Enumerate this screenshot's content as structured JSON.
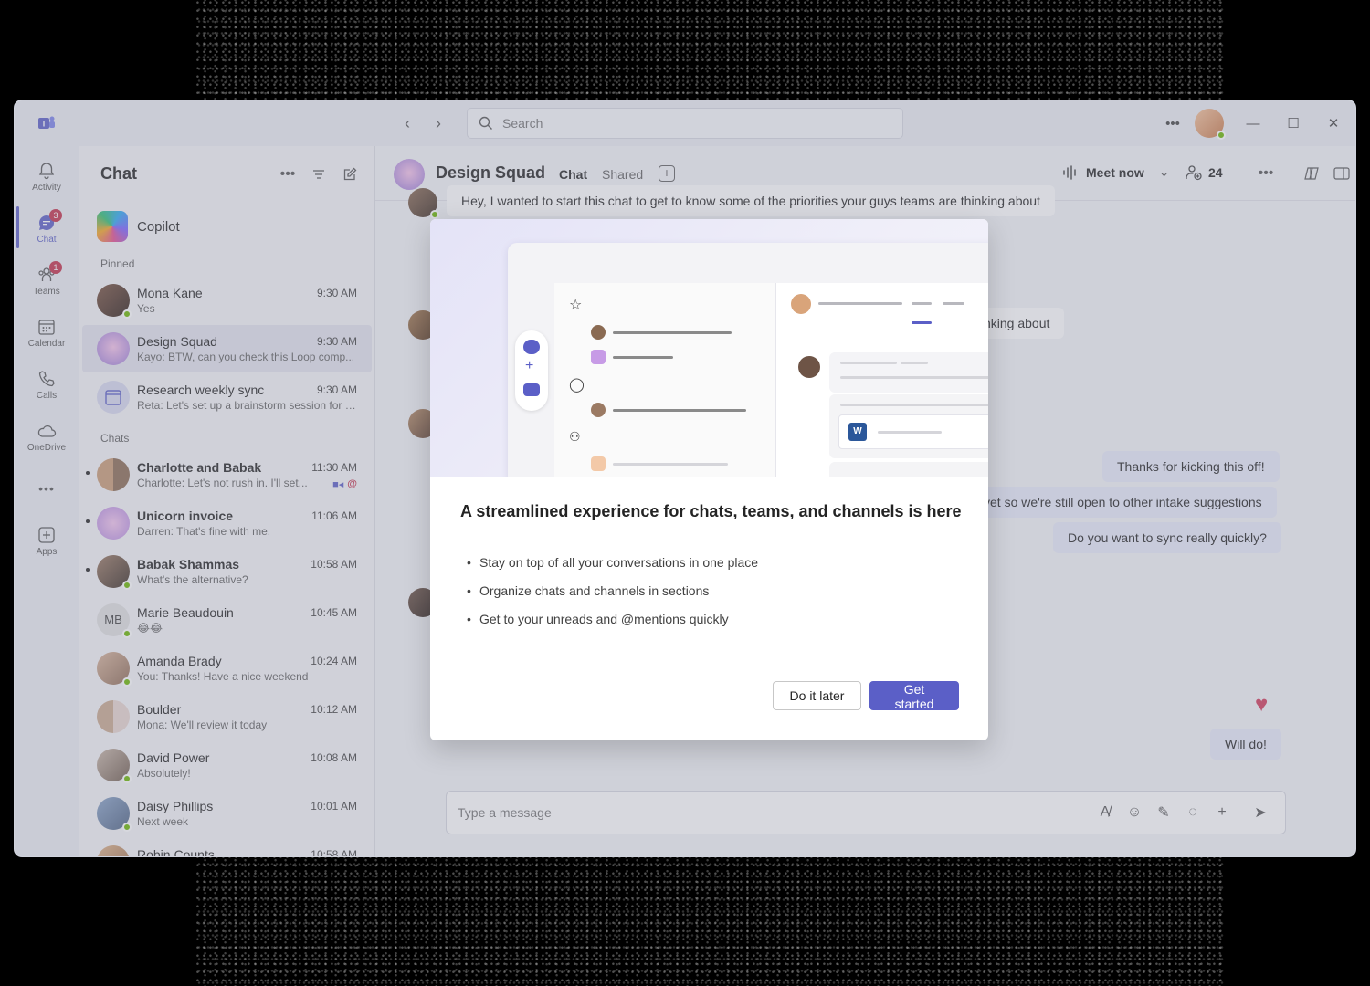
{
  "app": {
    "search_placeholder": "Search"
  },
  "rail": {
    "items": [
      {
        "label": "Activity",
        "icon": "bell-icon"
      },
      {
        "label": "Chat",
        "icon": "chat-icon",
        "badge": "3"
      },
      {
        "label": "Teams",
        "icon": "teams-icon",
        "badge": "1"
      },
      {
        "label": "Calendar",
        "icon": "calendar-icon"
      },
      {
        "label": "Calls",
        "icon": "phone-icon"
      },
      {
        "label": "OneDrive",
        "icon": "cloud-icon"
      },
      {
        "label": "Apps",
        "icon": "apps-add-icon"
      }
    ]
  },
  "chatlist": {
    "title": "Chat",
    "copilot_label": "Copilot",
    "pinned_label": "Pinned",
    "chats_label": "Chats",
    "pinned": [
      {
        "name": "Mona Kane",
        "time": "9:30 AM",
        "preview": "Yes"
      },
      {
        "name": "Design Squad",
        "time": "9:30 AM",
        "preview": "Kayo: BTW, can you check this Loop comp..."
      },
      {
        "name": "Research weekly sync",
        "time": "9:30 AM",
        "preview": "Reta: Let's set up a brainstorm session for t..."
      }
    ],
    "chats": [
      {
        "name": "Charlotte and Babak",
        "time": "11:30 AM",
        "preview": "Charlotte: Let's not rush in. I'll set..."
      },
      {
        "name": "Unicorn invoice",
        "time": "11:06 AM",
        "preview": "Darren: That's fine with me."
      },
      {
        "name": "Babak Shammas",
        "time": "10:58 AM",
        "preview": "What's the alternative?"
      },
      {
        "name": "Marie Beaudouin",
        "time": "10:45 AM",
        "preview": "😂😂",
        "initials": "MB"
      },
      {
        "name": "Amanda Brady",
        "time": "10:24 AM",
        "preview": "You: Thanks! Have a nice weekend"
      },
      {
        "name": "Boulder",
        "time": "10:12 AM",
        "preview": "Mona: We'll review it today"
      },
      {
        "name": "David Power",
        "time": "10:08 AM",
        "preview": "Absolutely!"
      },
      {
        "name": "Daisy Phillips",
        "time": "10:01 AM",
        "preview": "Next week"
      },
      {
        "name": "Robin Counts",
        "time": "10:58 AM",
        "preview": ""
      }
    ],
    "mention_symbol": "@"
  },
  "main": {
    "group_name": "Design Squad",
    "tab_chat": "Chat",
    "tab_shared": "Shared",
    "meet_now": "Meet now",
    "people_count": "24",
    "messages": {
      "m1": "Hey, I wanted to start this chat to get to know some of the priorities your guys teams are thinking about",
      "m2": "nking about",
      "m3": "Thanks for kicking this off!",
      "m4": "yet so we're still open to other intake suggestions",
      "m5": "Do you want to sync really quickly?",
      "m6": "Will do!"
    },
    "composer_placeholder": "Type a message"
  },
  "dialog": {
    "title": "A streamlined experience for chats, teams, and channels is here",
    "bullets": [
      "Stay on top of all your conversations in one place",
      "Organize chats and channels in sections",
      "Get to your unreads and @mentions quickly"
    ],
    "secondary_button": "Do it later",
    "primary_button": "Get started"
  },
  "colors": {
    "brand": "#5b5fc7",
    "presence": "#6bb700",
    "badge": "#c4314b"
  }
}
